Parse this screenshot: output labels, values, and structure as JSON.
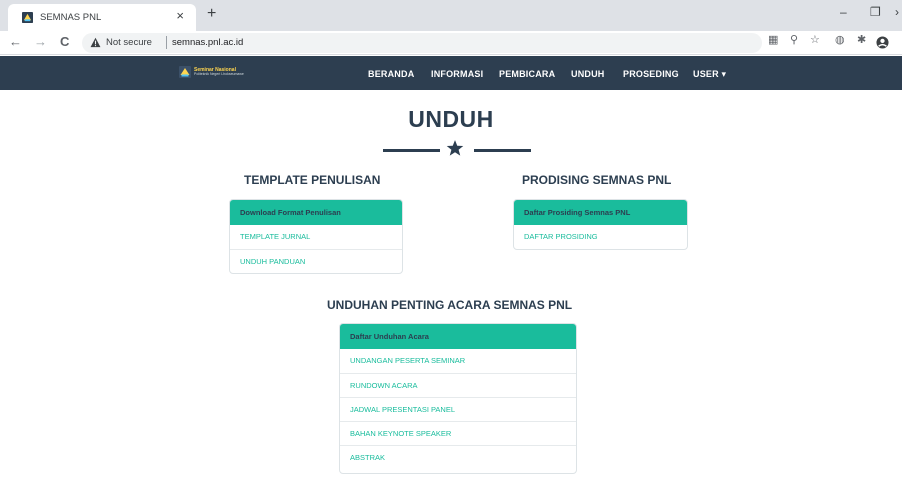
{
  "browser": {
    "tab_title": "SEMNAS PNL",
    "tab_close": "×",
    "new_tab": "+",
    "nav_back": "←",
    "nav_forward": "→",
    "nav_reload": "C",
    "security_label": "Not secure",
    "url": "semnas.pnl.ac.id",
    "window_minimize": "–",
    "window_restore": "❐",
    "window_close_partial": "›"
  },
  "site_nav": {
    "logo_line1": "Seminar Nasional",
    "logo_line2": "Politeknik Negeri Lhokseumawe",
    "items": [
      "BERANDA",
      "INFORMASI",
      "PEMBICARA",
      "UNDUH",
      "PROSEDING",
      "USER ▾"
    ]
  },
  "page": {
    "title": "UNDUH"
  },
  "template_section": {
    "heading": "TEMPLATE PENULISAN",
    "panel_header": "Download Format Penulisan",
    "items": [
      "TEMPLATE JURNAL",
      "UNDUH PANDUAN"
    ]
  },
  "prosiding_section": {
    "heading": "PRODISING SEMNAS PNL",
    "panel_header": "Daftar Prosiding Semnas PNL",
    "items": [
      "DAFTAR PROSIDING"
    ]
  },
  "unduhan_section": {
    "heading": "UNDUHAN PENTING ACARA SEMNAS PNL",
    "panel_header": "Daftar Unduhan Acara",
    "items": [
      "UNDANGAN PESERTA SEMINAR",
      "RUNDOWN ACARA",
      "JADWAL PRESENTASI PANEL",
      "BAHAN KEYNOTE SPEAKER",
      "ABSTRAK"
    ]
  },
  "colors": {
    "navbar_bg": "#2d3e50",
    "accent_green": "#1abc9c",
    "link_green": "#18bc9c",
    "heading_dark": "#2c3e50"
  },
  "icons": {
    "favicon": "semnas-logo-icon",
    "warning": "warning-triangle-icon",
    "divider": "star-icon"
  }
}
